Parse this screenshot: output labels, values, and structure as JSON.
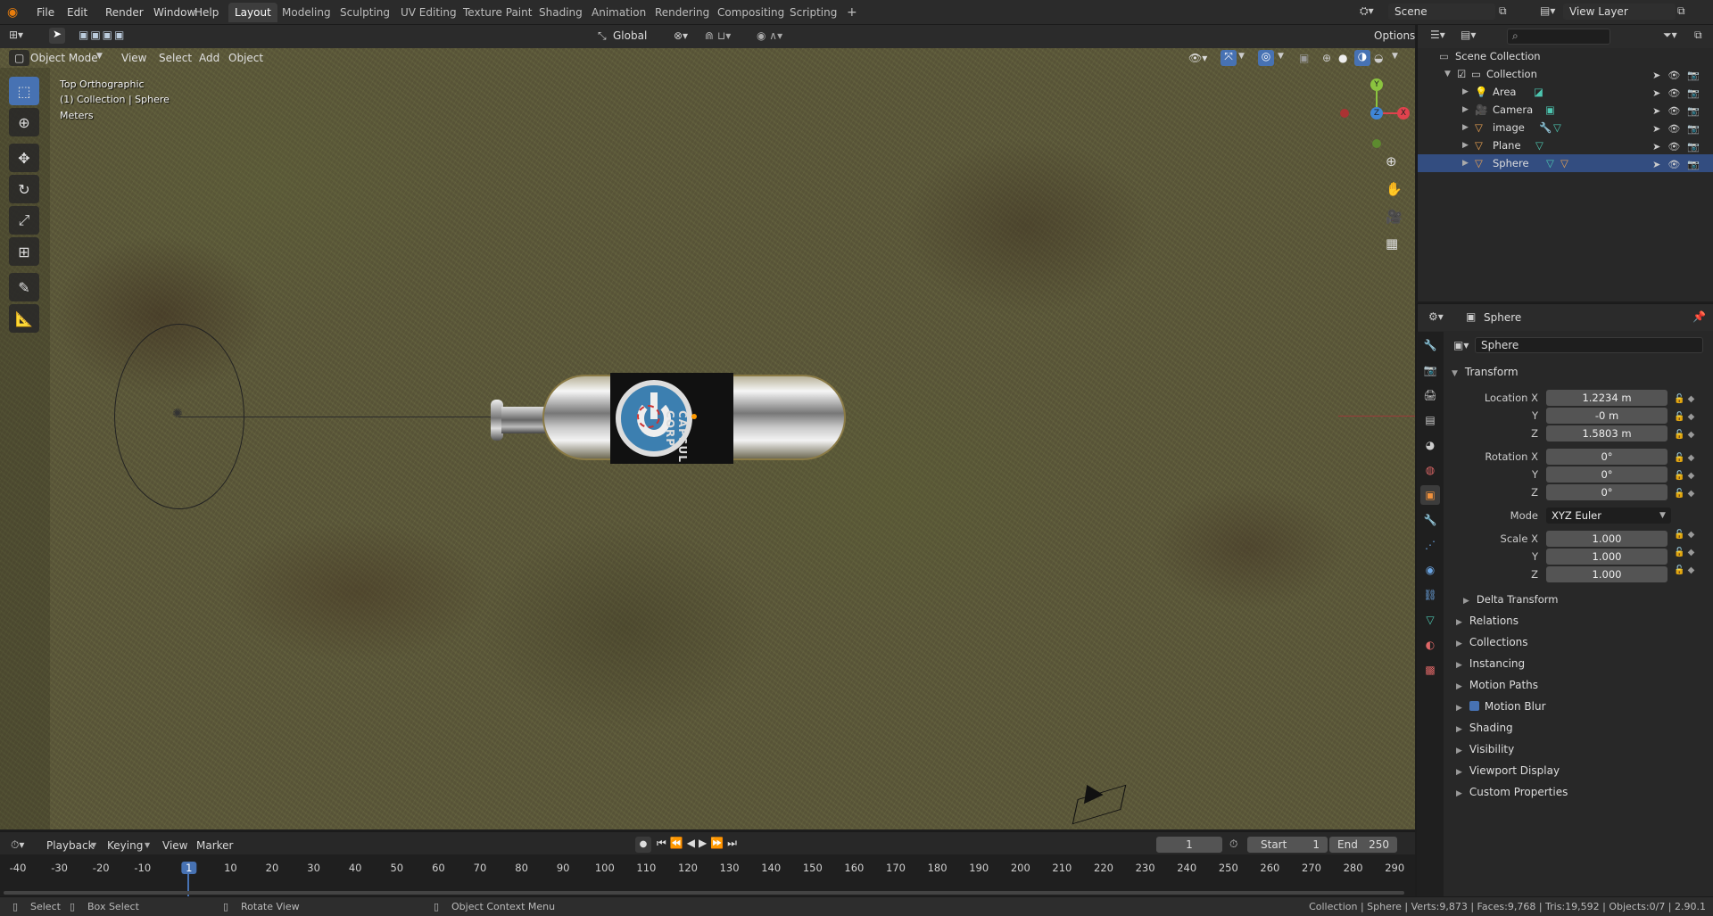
{
  "topbar": {
    "menus": [
      "File",
      "Edit",
      "Render",
      "Window",
      "Help"
    ],
    "workspaces": [
      "Layout",
      "Modeling",
      "Sculpting",
      "UV Editing",
      "Texture Paint",
      "Shading",
      "Animation",
      "Rendering",
      "Compositing",
      "Scripting",
      "+"
    ],
    "active_workspace": "Layout",
    "scene": "Scene",
    "view_layer": "View Layer"
  },
  "tool_header": {
    "orientation": "Global",
    "options": "Options"
  },
  "viewport_header": {
    "mode": "Object Mode",
    "menus": [
      "View",
      "Select",
      "Add",
      "Object"
    ]
  },
  "viewport": {
    "view_name": "Top Orthographic",
    "collection_line": "(1) Collection | Sphere",
    "units": "Meters",
    "bottle_label": "CAPSULE CORP"
  },
  "outliner": {
    "root": "Scene Collection",
    "collection": "Collection",
    "items": [
      "Area",
      "Camera",
      "image",
      "Plane",
      "Sphere"
    ]
  },
  "properties": {
    "header_object": "Sphere",
    "object_name": "Sphere",
    "transform_title": "Transform",
    "location_label": "Location X",
    "location": [
      "1.2234 m",
      "-0 m",
      "1.5803 m"
    ],
    "rotation_label": "Rotation X",
    "rotation": [
      "0°",
      "0°",
      "0°"
    ],
    "mode_label": "Mode",
    "mode_value": "XYZ Euler",
    "scale_label": "Scale X",
    "scale": [
      "1.000",
      "1.000",
      "1.000"
    ],
    "axis_y": "Y",
    "axis_z": "Z",
    "delta_transform": "Delta Transform",
    "panels": [
      "Relations",
      "Collections",
      "Instancing",
      "Motion Paths",
      "Motion Blur",
      "Shading",
      "Visibility",
      "Viewport Display",
      "Custom Properties"
    ]
  },
  "timeline": {
    "menus": [
      "Playback",
      "Keying",
      "View",
      "Marker"
    ],
    "current_frame": "1",
    "start_label": "Start",
    "start": "1",
    "end_label": "End",
    "end": "250",
    "ticks": [
      "-40",
      "-30",
      "-20",
      "-10",
      "1",
      "10",
      "20",
      "30",
      "40",
      "50",
      "60",
      "70",
      "80",
      "90",
      "100",
      "110",
      "120",
      "130",
      "140",
      "150",
      "160",
      "170",
      "180",
      "190",
      "200",
      "210",
      "220",
      "230",
      "240",
      "250",
      "260",
      "270",
      "280",
      "290"
    ]
  },
  "statusbar": {
    "select": "Select",
    "box_select": "Box Select",
    "rotate_view": "Rotate View",
    "context_menu": "Object Context Menu",
    "stats": "Collection | Sphere | Verts:9,873 | Faces:9,768 | Tris:19,592 | Objects:0/7 | 2.90.1"
  },
  "colors": {
    "accent": "#4772b3",
    "x_axis": "#e0424d",
    "y_axis": "#8bc43f",
    "z_axis": "#3f86d6"
  }
}
